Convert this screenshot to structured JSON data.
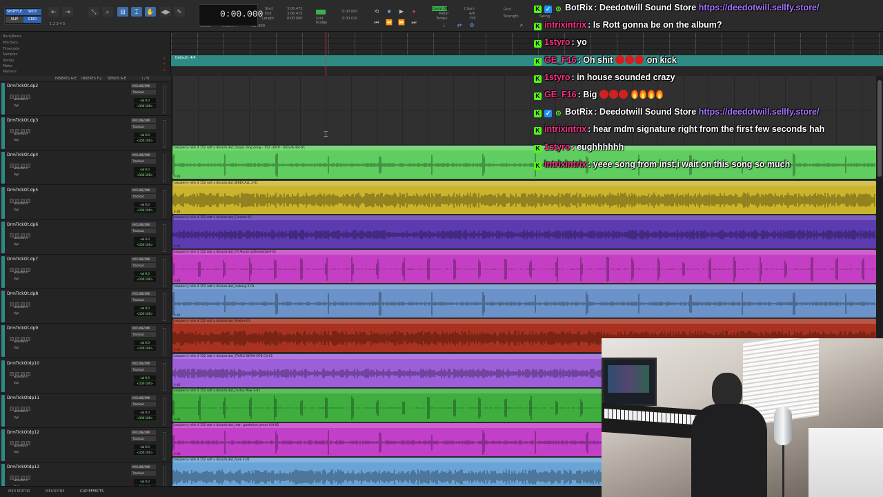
{
  "toolbar": {
    "mode_buttons": [
      "SHUFFLE",
      "SPOT",
      "SLIP",
      "GRID"
    ],
    "counter_main": "0:00.000",
    "counter_labels": [
      "Start",
      "End",
      "Length"
    ],
    "counter_values": [
      "3:06.473",
      "3:06.473",
      "0:00.000"
    ],
    "cursor_label": "Cursor",
    "cursor_value": "0:36.144",
    "sample_value": "284800",
    "nudge_label": "Nudge",
    "nudge_value": "0:00.010",
    "grid_label": "Grid",
    "grid_value": "0:00.000",
    "count_off_label": "Count Off",
    "count_off_value": "2 bars",
    "meter_label": "Meter",
    "meter_value": "4/4",
    "tempo_label": "Tempo",
    "tempo_value": "150",
    "strength_label": "Strength",
    "swing_label": "Swing"
  },
  "rulers": {
    "labels": [
      "Bars|Beats",
      "Min:Secs",
      "Timecode",
      "Samples",
      "Tempo",
      "Meter",
      "Markers"
    ],
    "marker_default": "Default: 4/4"
  },
  "track_header": {
    "cols": [
      "INSERTS A-E",
      "INSERTS F-J",
      "SENDS A-E",
      "I / O"
    ]
  },
  "tracks": [
    {
      "name": "DrmTrckOt.dp2",
      "io_in": "MICLINE/DMI",
      "io_out": "Trackout",
      "mode": "waveform",
      "vol": "vol 0.0",
      "pan": "<100 100>",
      "has_clip": false
    },
    {
      "name": "DrmTrckOt.dp3",
      "io_in": "MICLINE/DMI",
      "io_out": "Trackout",
      "mode": "waveform",
      "vol": "vol 0.0",
      "pan": "<100 100>",
      "has_clip": false
    },
    {
      "name": "DrmTrckOt.dp4",
      "io_in": "MICLINE/DMI",
      "io_out": "Trackout",
      "mode": "waveform",
      "vol": "vol 0.0",
      "pan": "<100 100>",
      "has_clip": true,
      "color": "#5fcd5f",
      "clip_name": "raspberry hills 4 152 rott x disturb.dot_Ooops ding dong - 152 -30ctl - disturb.dot-01"
    },
    {
      "name": "DrmTrckOt.dp5",
      "io_in": "MICLINE/DMI",
      "io_out": "Trackout",
      "mode": "waveform",
      "vol": "vol 0.0",
      "pan": "<100 100>",
      "has_clip": true,
      "color": "#c9b42c",
      "clip_name": "raspberry hills 4 152 rott x disturb.dot_BIRDCALL 2-01"
    },
    {
      "name": "DrmTrckOt.dp6",
      "io_in": "MICLINE/DMI",
      "io_out": "Trackout",
      "mode": "waveform",
      "vol": "vol 0.0",
      "pan": "<100 100>",
      "has_clip": true,
      "color": "#5c3bb0",
      "clip_name": "raspberry hills 4 152 rott x disturb.dot_Current-01"
    },
    {
      "name": "DrmTrckOt.dp7",
      "io_in": "MICLINE/DMI",
      "io_out": "Trackout",
      "mode": "waveform",
      "vol": "vol 0.0",
      "pan": "<100 100>",
      "has_clip": true,
      "color": "#c43fc4",
      "clip_name": "raspberry hills 4 152 rott x disturb.dot_FX Plucks @Deedottwill-01"
    },
    {
      "name": "DrmTrckOt.dp8",
      "io_in": "MICLINE/DMI",
      "io_out": "Trackout",
      "mode": "waveform",
      "vol": "vol 0.0",
      "pan": "<100 100>",
      "has_clip": true,
      "color": "#6b93c9",
      "clip_name": "raspberry hills 4 152 rott x disturb.dot_Iceberg 2-01"
    },
    {
      "name": "DrmTrckOt.dp9",
      "io_in": "MICLINE/DMI",
      "io_out": "Trackout",
      "mode": "waveform",
      "vol": "vol 0.0",
      "pan": "<100 100>",
      "has_clip": true,
      "color": "#a8321f",
      "clip_name": "raspberry hills 4 152 rott x disturb.dot_Master-01"
    },
    {
      "name": "DrmTrckOtdp10",
      "io_in": "MICLINE/DMI",
      "io_out": "Trackout",
      "mode": "waveform",
      "vol": "vol 0.0",
      "pan": "<100 100>",
      "has_clip": true,
      "color": "#9c5fd9",
      "clip_name": "raspberry hills 4 152 rott x disturb.dot_TRIPLE BEAM OTB C4-01"
    },
    {
      "name": "DrmTrckOtdp11",
      "io_in": "MICLINE/DMI",
      "io_out": "Trackout",
      "mode": "waveform",
      "vol": "vol 0.0",
      "pan": "<100 100>",
      "has_clip": true,
      "color": "#3fae3f",
      "clip_name": "raspberry hills 4 152 rott x disturb.dot_cactus flow 3-01"
    },
    {
      "name": "DrmTrckOtdp12",
      "io_in": "MICLINE/DMI",
      "io_out": "Trackout",
      "mode": "waveform",
      "vol": "vol 0.0",
      "pan": "<100 100>",
      "has_clip": true,
      "color": "#c23fc8",
      "clip_name": "raspberry hills 4 152 rott x disturb.dot_rott - goldmine james OH-01"
    },
    {
      "name": "DrmTrckOtdp13",
      "io_in": "MICLINE/DMI",
      "io_out": "Trackout",
      "mode": "waveform",
      "vol": "vol 0.0",
      "pan": "<100 100>",
      "has_clip": true,
      "color": "#6aa3d6",
      "clip_name": "raspberry hills 4 152 rott x disturb.dot_funk 1-01"
    }
  ],
  "bottom_bar": {
    "items": [
      "MIDI EDITOR",
      "MELODYNE",
      "CLIP EFFECTS"
    ]
  },
  "chat": [
    {
      "user": "BotRix",
      "user_color": "#ffffff",
      "badges": [
        "kick",
        "verified",
        "check"
      ],
      "text": ": Deedotwill Sound Store ",
      "link": "https://deedotwill.sellfy.store/"
    },
    {
      "user": "intrixintrix",
      "user_color": "#ff2e8a",
      "badges": [
        "kick"
      ],
      "text": ": Is Rott gonna be on the album?"
    },
    {
      "user": "1styro",
      "user_color": "#ff2e8a",
      "badges": [
        "kick"
      ],
      "text": ": yo"
    },
    {
      "user": "GE_F16",
      "user_color": "#ff2e8a",
      "badges": [
        "kick"
      ],
      "text": ": Oh shit",
      "emoji": "red3",
      "text_after": " on kick"
    },
    {
      "user": "1styro",
      "user_color": "#ff2e8a",
      "badges": [
        "kick"
      ],
      "text": ": in house sounded crazy"
    },
    {
      "user": "GE_F16",
      "user_color": "#ff2e8a",
      "badges": [
        "kick"
      ],
      "text": ": Big",
      "emoji": "red3fire4"
    },
    {
      "user": "BotRix",
      "user_color": "#ffffff",
      "badges": [
        "kick",
        "verified",
        "check"
      ],
      "text": ": Deedotwill Sound Store ",
      "link": "https://deedotwill.sellfy.store/"
    },
    {
      "user": "intrixintrix",
      "user_color": "#ff2e8a",
      "badges": [
        "kick"
      ],
      "text": ": hear mdm signature right from the first few seconds hah"
    },
    {
      "user": "1styro",
      "user_color": "#ff2e8a",
      "badges": [
        "kick"
      ],
      "text": ": eughhhhhh"
    },
    {
      "user": "intrixintrix",
      "user_color": "#ff2e8a",
      "badges": [
        "kick"
      ],
      "text": ": yeee song from inst,i wait on this song so much"
    }
  ]
}
